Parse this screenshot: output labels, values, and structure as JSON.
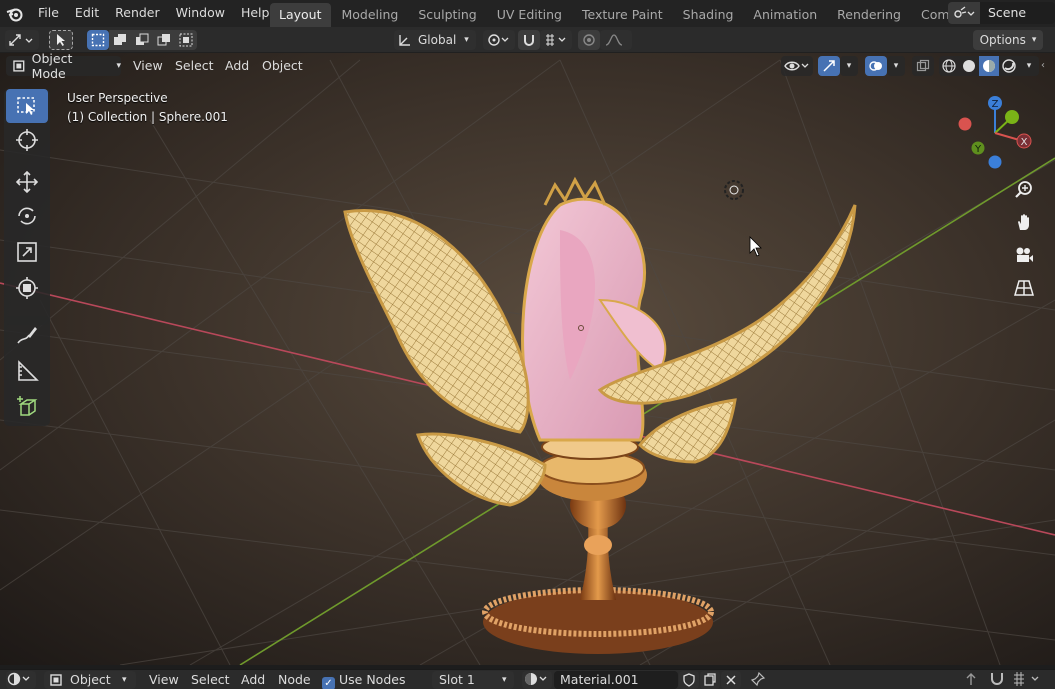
{
  "top_menu": {
    "items": [
      "File",
      "Edit",
      "Render",
      "Window",
      "Help"
    ]
  },
  "workspace_tabs": [
    {
      "label": "Layout",
      "active": true
    },
    {
      "label": "Modeling",
      "active": false
    },
    {
      "label": "Sculpting",
      "active": false
    },
    {
      "label": "UV Editing",
      "active": false
    },
    {
      "label": "Texture Paint",
      "active": false
    },
    {
      "label": "Shading",
      "active": false
    },
    {
      "label": "Animation",
      "active": false
    },
    {
      "label": "Rendering",
      "active": false
    },
    {
      "label": "Compositing",
      "active": false
    }
  ],
  "scene": {
    "name": "Scene"
  },
  "tool_settings": {
    "transform_orientation": "Global",
    "options_label": "Options"
  },
  "viewport_header": {
    "mode": "Object Mode",
    "menus": [
      "View",
      "Select",
      "Add",
      "Object"
    ]
  },
  "viewport_info": {
    "perspective": "User Perspective",
    "collection": "(1) Collection | Sphere.001"
  },
  "gizmo_axes": [
    "Z",
    "Y",
    "X"
  ],
  "bottom_bar": {
    "editor_type": "Object",
    "menus": [
      "View",
      "Select",
      "Add",
      "Node"
    ],
    "use_nodes_label": "Use Nodes",
    "use_nodes_checked": true,
    "slot": "Slot 1",
    "material": "Material.001"
  },
  "colors": {
    "accent": "#4772b3",
    "x_axis": "#d9534f",
    "y_axis": "#7ab317",
    "z_axis": "#3b7fd9",
    "x_line": "#b8485a",
    "y_line": "#6f9a2c"
  }
}
